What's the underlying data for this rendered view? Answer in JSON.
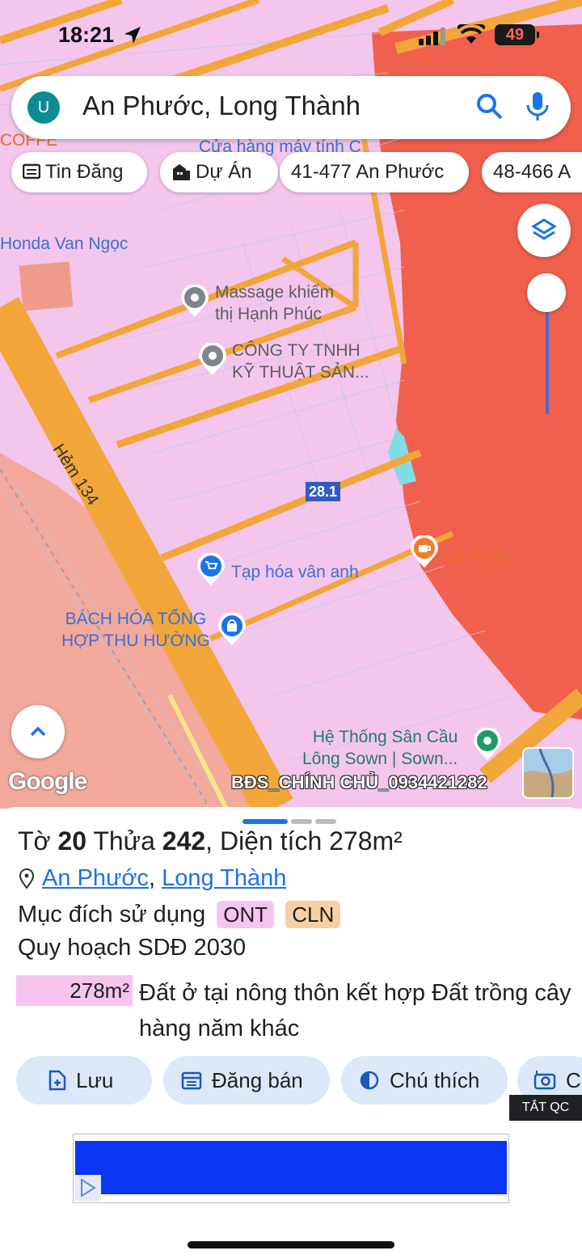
{
  "status_bar": {
    "time": "18:21",
    "battery": "49"
  },
  "search": {
    "avatar_letter": "U",
    "query": "An Phước, Long Thành"
  },
  "chips": [
    {
      "label": "Tin Đăng",
      "icon": "newspaper-icon"
    },
    {
      "label": "Dự Án",
      "icon": "building-icon"
    },
    {
      "label": "41-477 An Phước",
      "icon": ""
    },
    {
      "label": "48-466 A",
      "icon": ""
    }
  ],
  "map": {
    "pois": [
      {
        "name": "Cửa hàng máy tính C",
        "color": "blue"
      },
      {
        "name": "COFFE",
        "color": "orange"
      },
      {
        "name": "Honda Van Ngọc",
        "color": "blue"
      },
      {
        "name": "Massage khiếm thị Hạnh Phúc",
        "line1": "Massage khiếm",
        "line2": "thị Hạnh Phúc",
        "color": "grey"
      },
      {
        "name": "CÔNG TY TNHH KỸ THUẬT SẢN...",
        "line1": "CÔNG TY TNHH",
        "line2": "KỸ THUẬT SẢN...",
        "color": "grey"
      },
      {
        "name": "Tạp hóa vân anh",
        "color": "blue"
      },
      {
        "name": "BÁCH HÓA TỔNG HỢP THU HƯỜNG",
        "line1": "BÁCH HÓA TỔNG",
        "line2": "HỢP THU HƯỜNG",
        "color": "blue"
      },
      {
        "name": "Lê Hùng",
        "color": "orange"
      },
      {
        "name": "Hệ Thống Sân Cầu Lông Sown | Sown...",
        "line1": "Hệ Thống Sân Cầu",
        "line2": "Lông Sown | Sown...",
        "color": "green"
      }
    ],
    "road_label": "Hẻm 134",
    "parcel_label": "28.1",
    "google_logo": "Google",
    "watermark": "BĐS_CHÍNH CHỦ_0934421282",
    "colors": {
      "residential": "#f4c6ec",
      "forest": "#f15f4d",
      "agri": "#f2a89b",
      "road": "#f2a63a"
    }
  },
  "sheet": {
    "title_pre": "Tờ ",
    "sheet_no": "20",
    "title_mid": " Thửa ",
    "parcel_no": "242",
    "title_post": ", Diện tích ",
    "area": "278m²",
    "location_commune": "An Phước",
    "location_sep": ", ",
    "location_district": "Long Thành",
    "purpose_label": "Mục đích sử dụng",
    "tags": [
      {
        "code": "ONT",
        "color": "#f6c4ee"
      },
      {
        "code": "CLN",
        "color": "#f6d0a4"
      }
    ],
    "plan_label": "Quy hoạch SDĐ 2030",
    "plan_area": "278m²",
    "plan_desc": "Đất ở tại nông thôn kết hợp Đất trồng cây hàng năm khác",
    "buttons": [
      {
        "label": "Lưu",
        "icon": "add-file-icon"
      },
      {
        "label": "Đăng bán",
        "icon": "calendar-icon"
      },
      {
        "label": "Chú thích",
        "icon": "contrast-icon"
      },
      {
        "label": "C",
        "icon": "camera-icon"
      }
    ],
    "ad_label": "TẮT QC"
  }
}
